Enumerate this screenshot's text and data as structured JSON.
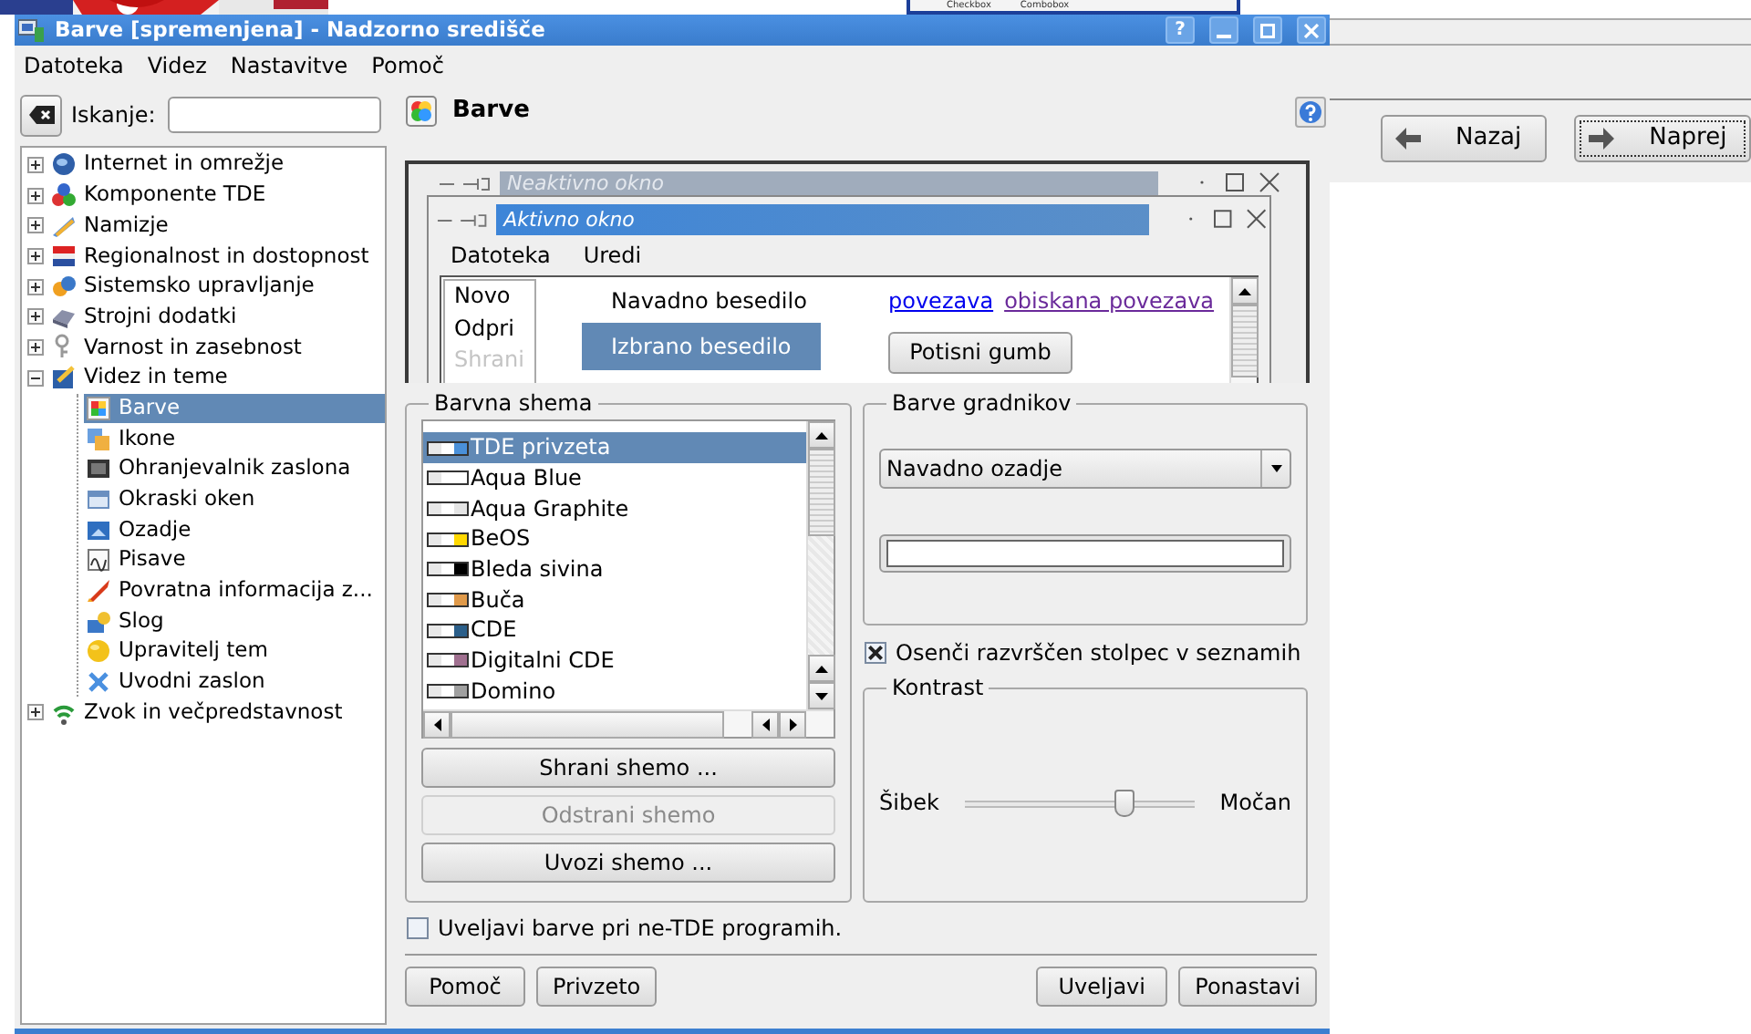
{
  "background": {
    "top_window": [
      "Checkbox",
      "Combobox"
    ],
    "nav_buttons": [
      {
        "label": "Nazaj",
        "kind": "back",
        "focused": false
      },
      {
        "label": "Naprej",
        "kind": "forward",
        "focused": true
      }
    ]
  },
  "window": {
    "title": "Barve [spremenjena] - Nadzorno središče",
    "help_button": "?"
  },
  "menu": [
    "Datoteka",
    "Videz",
    "Nastavitve",
    "Pomoč"
  ],
  "search": {
    "label": "Iskanje:"
  },
  "tree": [
    {
      "label": "Internet in omrežje",
      "expanded": false,
      "selected": false
    },
    {
      "label": "Komponente TDE",
      "expanded": false,
      "selected": false
    },
    {
      "label": "Namizje",
      "expanded": false,
      "selected": false
    },
    {
      "label": "Regionalnost in dostopnost",
      "expanded": false,
      "selected": false
    },
    {
      "label": "Sistemsko upravljanje",
      "expanded": false,
      "selected": false
    },
    {
      "label": "Strojni dodatki",
      "expanded": false,
      "selected": false
    },
    {
      "label": "Varnost in zasebnost",
      "expanded": false,
      "selected": false
    },
    {
      "label": "Videz in teme",
      "expanded": true,
      "selected": false,
      "children": [
        {
          "label": "Barve",
          "selected": true
        },
        {
          "label": "Ikone",
          "selected": false
        },
        {
          "label": "Ohranjevalnik zaslona",
          "selected": false
        },
        {
          "label": "Okraski oken",
          "selected": false
        },
        {
          "label": "Ozadje",
          "selected": false
        },
        {
          "label": "Pisave",
          "selected": false
        },
        {
          "label": "Povratna informacija z...",
          "selected": false
        },
        {
          "label": "Slog",
          "selected": false
        },
        {
          "label": "Upravitelj tem",
          "selected": false
        },
        {
          "label": "Uvodni zaslon",
          "selected": false
        }
      ]
    },
    {
      "label": "Zvok in večpredstavnost",
      "expanded": false,
      "selected": false
    }
  ],
  "module": {
    "title": "Barve"
  },
  "preview": {
    "inactive_title": "Neaktivno okno",
    "active_title": "Aktivno okno",
    "menu": [
      "Datoteka",
      "Uredi"
    ],
    "popup": [
      {
        "label": "Novo",
        "disabled": false
      },
      {
        "label": "Odpri",
        "disabled": false
      },
      {
        "label": "Shrani",
        "disabled": true
      }
    ],
    "normal_text": "Navadno besedilo",
    "selected_text": "Izbrano besedilo",
    "link": "povezava",
    "visited_link": "obiskana povezava",
    "button": "Potisni gumb"
  },
  "color_scheme": {
    "title": "Barvna shema",
    "items": [
      {
        "label": "TDE privzeta",
        "selected": true,
        "color": "#4a90d9"
      },
      {
        "label": "Aqua Blue",
        "selected": false,
        "color": "#ffffff"
      },
      {
        "label": "Aqua Graphite",
        "selected": false,
        "color": "#e4e4e4"
      },
      {
        "label": "BeOS",
        "selected": false,
        "color": "#ffd800"
      },
      {
        "label": "Bleda sivina",
        "selected": false,
        "color": "#000000"
      },
      {
        "label": "Buča",
        "selected": false,
        "color": "#e09a4a"
      },
      {
        "label": "CDE",
        "selected": false,
        "color": "#2b5f8a"
      },
      {
        "label": "Digitalni CDE",
        "selected": false,
        "color": "#a07090"
      },
      {
        "label": "Domino",
        "selected": false,
        "color": "#a0a0a0"
      }
    ],
    "buttons": [
      {
        "label": "Shrani shemo ...",
        "disabled": false
      },
      {
        "label": "Odstrani shemo",
        "disabled": true
      },
      {
        "label": "Uvozi shemo ...",
        "disabled": false
      }
    ]
  },
  "widget_colors": {
    "title": "Barve gradnikov",
    "selected_widget": "Navadno ozadje",
    "color": "#ffffff"
  },
  "shade_sorted_column": {
    "label": "Osenči razvrščen stolpec v seznamih",
    "checked": true
  },
  "contrast": {
    "title": "Kontrast",
    "low_label": "Šibek",
    "high_label": "Močan",
    "level": 0.69
  },
  "apply_to_non_tde": {
    "label": "Uveljavi barve pri ne-TDE programih.",
    "checked": false
  },
  "footer": {
    "left_buttons": [
      "Pomoč",
      "Privzeto"
    ],
    "right_buttons": [
      "Uveljavi",
      "Ponastavi"
    ]
  }
}
